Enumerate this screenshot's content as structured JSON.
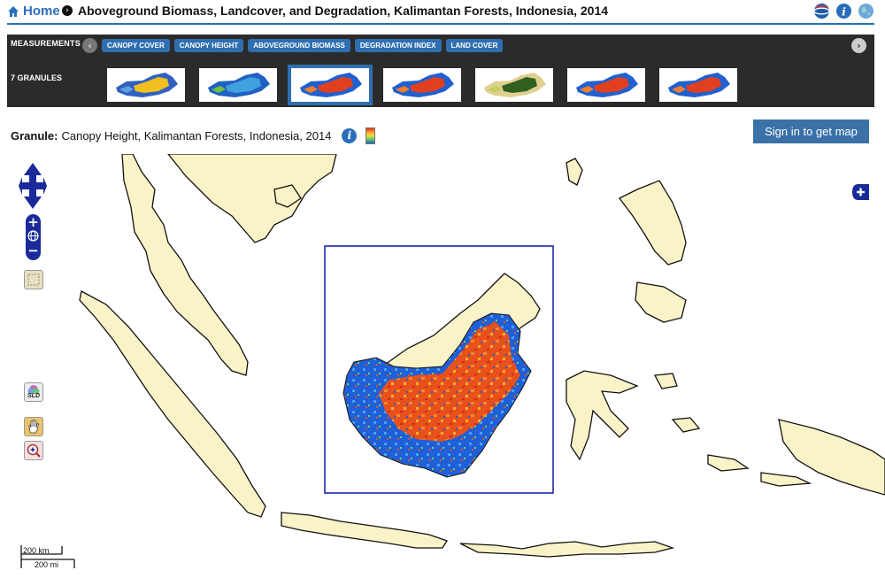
{
  "header": {
    "home_label": "Home",
    "title": "Aboveground Biomass, Landcover, and Degradation, Kalimantan Forests, Indonesia, 2014",
    "icons": [
      "globe-icon",
      "info-icon",
      "earth-icon"
    ]
  },
  "panel": {
    "measurements_label": "MEASUREMENTS",
    "measurements": [
      "CANOPY COVER",
      "CANOPY HEIGHT",
      "ABOVEGROUND BIOMASS",
      "DEGRADATION INDEX",
      "LAND COVER"
    ],
    "granules_label": "7 GRANULES",
    "thumbnails": [
      {
        "name": "thumb-1",
        "palette": [
          "#f0c020",
          "#60a0e0",
          "#3060c0"
        ]
      },
      {
        "name": "thumb-2",
        "palette": [
          "#40a0e0",
          "#70c040",
          "#2060c0"
        ]
      },
      {
        "name": "thumb-3",
        "palette": [
          "#e04020",
          "#f08030",
          "#2060d0"
        ],
        "selected": true
      },
      {
        "name": "thumb-4",
        "palette": [
          "#e04020",
          "#f08030",
          "#2060d0"
        ]
      },
      {
        "name": "thumb-5",
        "palette": [
          "#306020",
          "#c0d060",
          "#e0d090"
        ]
      },
      {
        "name": "thumb-6",
        "palette": [
          "#e04020",
          "#f08030",
          "#2060d0"
        ]
      },
      {
        "name": "thumb-7",
        "palette": [
          "#e04020",
          "#f08030",
          "#2060d0"
        ]
      }
    ]
  },
  "granule": {
    "label": "Granule:",
    "value": "Canopy Height, Kalimantan Forests, Indonesia, 2014"
  },
  "signin_label": "Sign in to get map",
  "map": {
    "zoom_in": "+",
    "zoom_out": "−",
    "sld_label": "SLD",
    "scale_km": "200 km",
    "scale_mi": "200 mi",
    "colors": {
      "land": "#faf3c8",
      "ocean": "#ffffff",
      "coast": "#111111",
      "bbox": "#1a28a8"
    }
  }
}
